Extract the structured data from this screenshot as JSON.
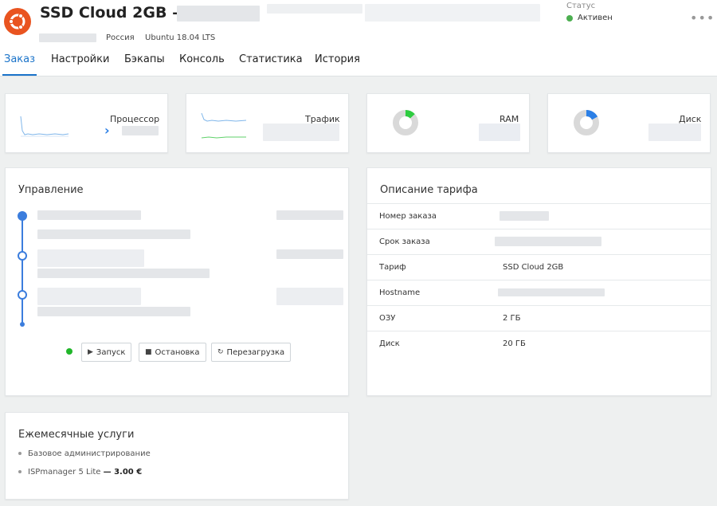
{
  "header": {
    "title": "SSD Cloud 2GB —",
    "country": "Россия",
    "os": "Ubuntu 18.04 LTS",
    "status_label": "Статус",
    "status_value": "Активен",
    "more": "•••",
    "os_icon": "ubuntu-logo",
    "accent_color": "#1a73c9",
    "status_color": "#4caf50"
  },
  "tabs": [
    {
      "label": "Заказ"
    },
    {
      "label": "Настройки"
    },
    {
      "label": "Бэкапы"
    },
    {
      "label": "Консоль"
    },
    {
      "label": "Статистика"
    },
    {
      "label": "История"
    }
  ],
  "metrics": {
    "cpu_label": "Процессор",
    "traffic_label": "Трафик",
    "ram_label": "RAM",
    "disk_label": "Диск",
    "ram_fraction": 0.13,
    "disk_fraction": 0.17,
    "ram_color": "#2ecc40",
    "disk_color": "#2b7fe6"
  },
  "control": {
    "title": "Управление",
    "start_label": "Запуск",
    "stop_label": "Остановка",
    "restart_label": "Перезагрузка"
  },
  "tariff": {
    "title": "Описание тарифа",
    "rows": [
      {
        "key": "Номер заказа",
        "value": ""
      },
      {
        "key": "Срок заказа",
        "value": ""
      },
      {
        "key": "Тариф",
        "value": "SSD Cloud 2GB"
      },
      {
        "key": "Hostname",
        "value": ""
      },
      {
        "key": "ОЗУ",
        "value": "2 ГБ"
      },
      {
        "key": "Диск",
        "value": "20 ГБ"
      }
    ]
  },
  "services": {
    "title": "Ежемесячные услуги",
    "items": [
      {
        "name": "Базовое администрирование",
        "price": ""
      },
      {
        "name": "ISPmanager 5 Lite",
        "price": "— 3.00 €"
      }
    ]
  }
}
